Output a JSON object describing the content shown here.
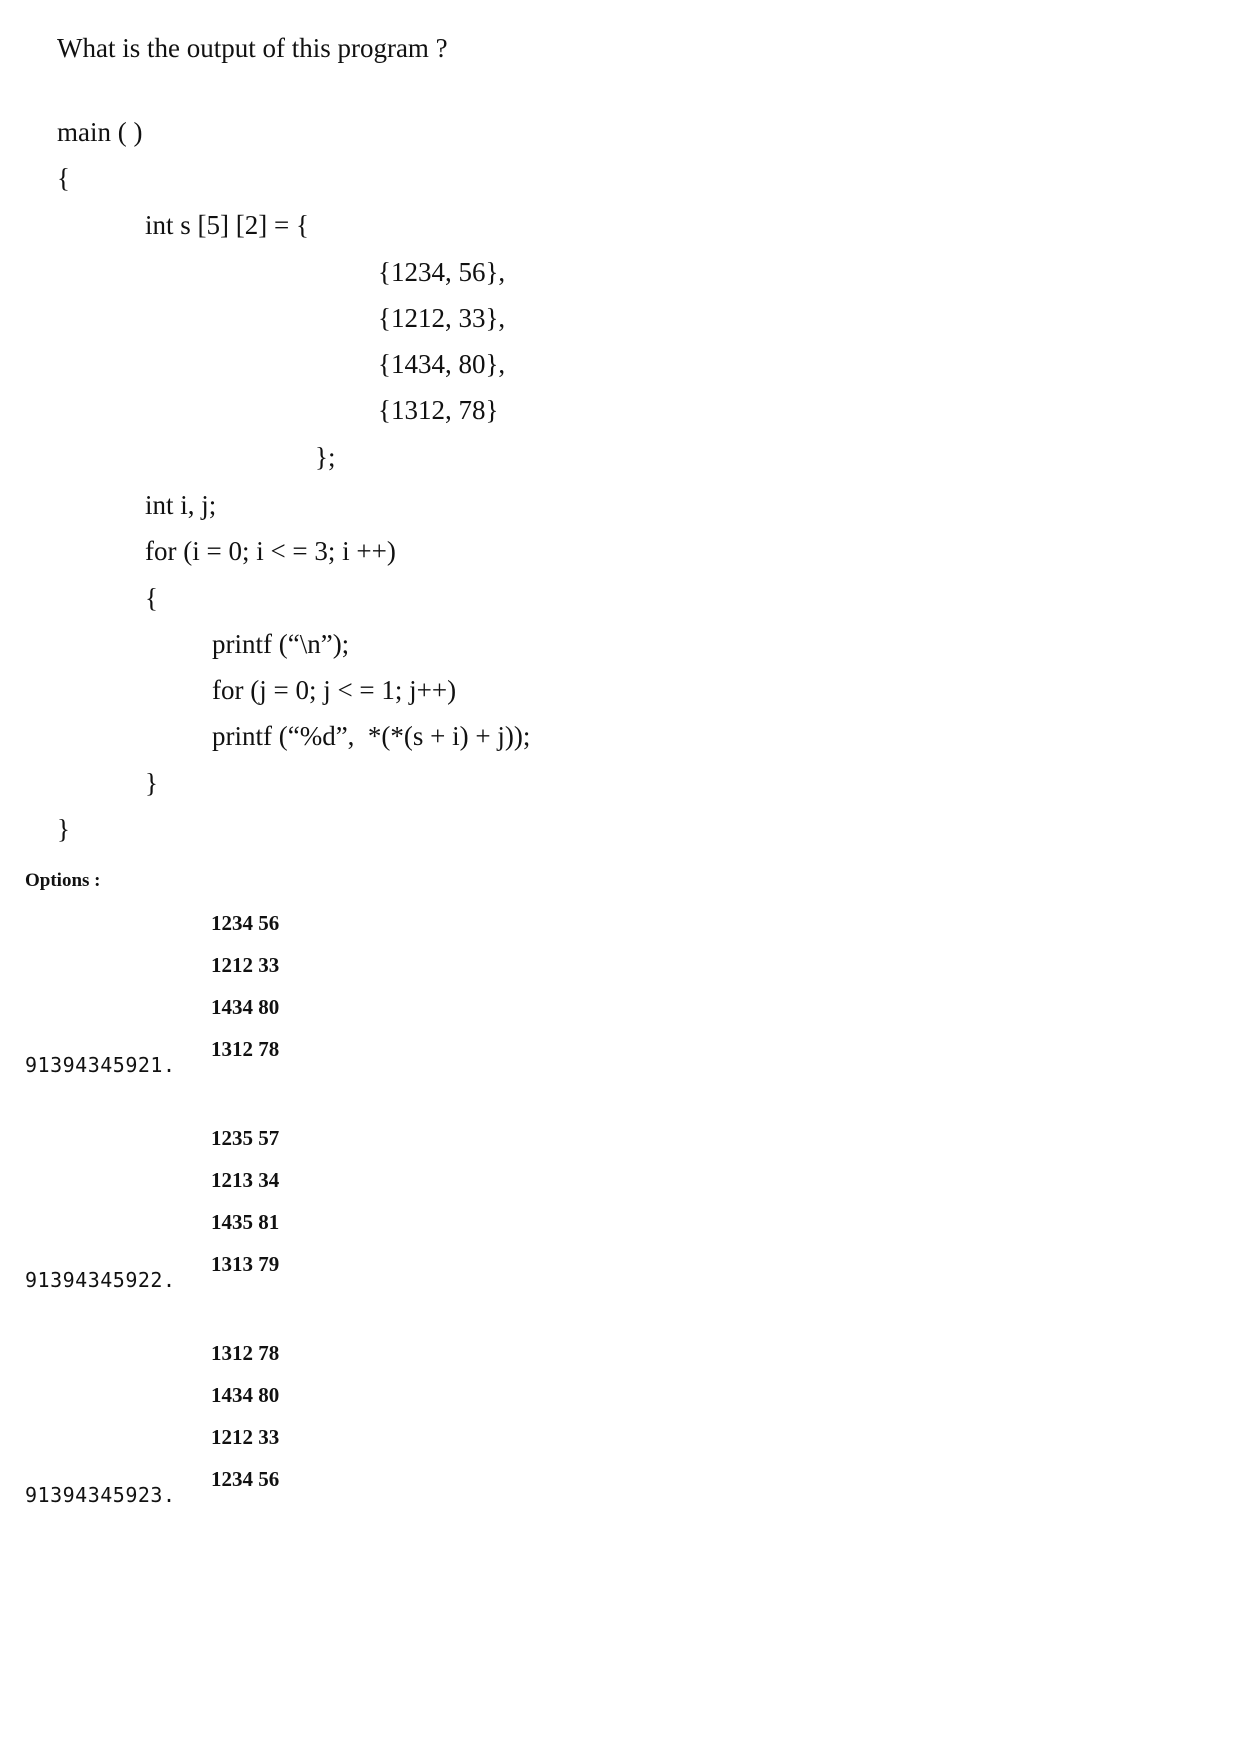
{
  "question": {
    "title": "What is the output of this program ?",
    "code_lines": [
      "main ( )",
      "{",
      "int s [5] [2] = {",
      "{1234, 56},",
      "{1212, 33},",
      "{1434, 80},",
      "{1312, 78}",
      "};",
      "int i, j;",
      "for (i = 0; i < = 3; i ++)",
      "{",
      "printf (“\\n”);",
      "for (j = 0; j < = 1; j++)",
      "printf (“%d”,  *(*(s + i) + j));",
      "}",
      "}"
    ]
  },
  "options": {
    "label": "Options :",
    "items": [
      {
        "id": "91394345921.",
        "lines": [
          "1234 56",
          "1212 33",
          "1434 80",
          "1312 78"
        ]
      },
      {
        "id": "91394345922.",
        "lines": [
          "1235 57",
          "1213 34",
          "1435 81",
          "1313 79"
        ]
      },
      {
        "id": "91394345923.",
        "lines": [
          "1312 78",
          "1434 80",
          "1212 33",
          "1234 56"
        ]
      }
    ]
  }
}
